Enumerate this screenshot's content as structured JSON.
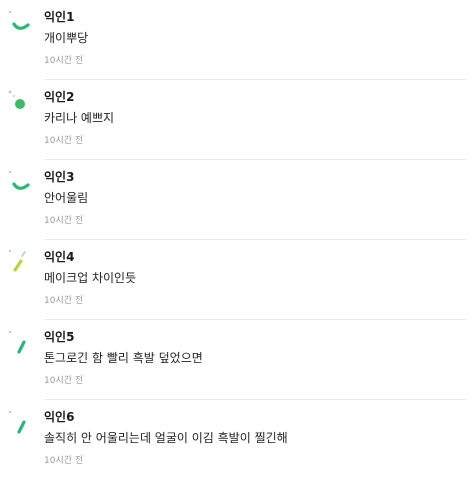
{
  "comments": [
    {
      "author": "익인1",
      "text": "개이뿌당",
      "time": "10시간 전",
      "avatar_icon": "green-arc-icon",
      "avatar_color": "#2bb673"
    },
    {
      "author": "익인2",
      "text": "카리나 예쁘지",
      "time": "10시간 전",
      "avatar_icon": "green-dot-icon",
      "avatar_color": "#3cba6a"
    },
    {
      "author": "익인3",
      "text": "안어울림",
      "time": "10시간 전",
      "avatar_icon": "green-arc-icon",
      "avatar_color": "#2bb673"
    },
    {
      "author": "익인4",
      "text": "메이크업 차이인듯",
      "time": "10시간 전",
      "avatar_icon": "yellow-green-slash-icon",
      "avatar_color": "#b5d334"
    },
    {
      "author": "익인5",
      "text": "톤그로긴 함 빨리 흑발 덮었으면",
      "time": "10시간 전",
      "avatar_icon": "green-slash-icon",
      "avatar_color": "#2bb673"
    },
    {
      "author": "익인6",
      "text": "솔직히 안 어울리는데 얼굴이 이김 흑발이 찔긴해",
      "time": "10시간 전",
      "avatar_icon": "green-slash-icon",
      "avatar_color": "#2bb673"
    }
  ]
}
